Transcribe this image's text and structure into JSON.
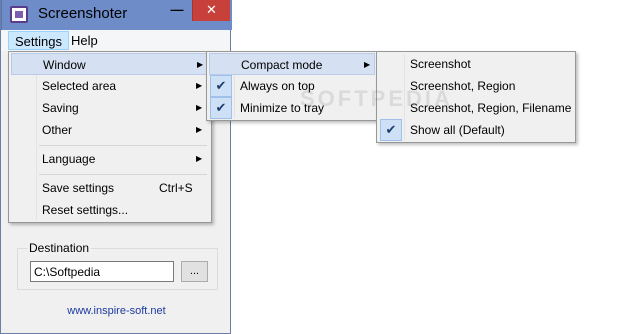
{
  "window": {
    "title": "Screenshoter",
    "minimize_glyph": "—",
    "close_glyph": "✕",
    "icon": "screenshoter-app-icon"
  },
  "menubar": {
    "settings": "Settings",
    "help": "Help"
  },
  "settings_menu": {
    "items": [
      {
        "label": "Window",
        "submenu": true
      },
      {
        "label": "Selected area",
        "submenu": true
      },
      {
        "label": "Saving",
        "submenu": true
      },
      {
        "label": "Other",
        "submenu": true
      },
      {
        "label": "Language",
        "submenu": true
      },
      {
        "label": "Save settings",
        "shortcut": "Ctrl+S"
      },
      {
        "label": "Reset settings..."
      }
    ]
  },
  "window_menu": {
    "items": [
      {
        "label": "Compact mode",
        "submenu": true,
        "checked": false
      },
      {
        "label": "Always on top",
        "checked": true
      },
      {
        "label": "Minimize to tray",
        "checked": true
      }
    ]
  },
  "compact_menu": {
    "items": [
      {
        "label": "Screenshot",
        "checked": false
      },
      {
        "label": "Screenshot, Region",
        "checked": false
      },
      {
        "label": "Screenshot, Region, Filename",
        "checked": false
      },
      {
        "label": "Show all (Default)",
        "checked": true
      }
    ]
  },
  "destination": {
    "label": "Destination",
    "value": "C:\\Softpedia",
    "browse_label": "..."
  },
  "footer": {
    "link": "www.inspire-soft.net"
  },
  "glyphs": {
    "arrow": "▶",
    "check": "✔"
  },
  "watermark": "SOFTPEDIA",
  "colors": {
    "titlebar": "#6e8cc8",
    "close_button": "#c7413a",
    "menu_highlight": "#d5e1f2",
    "link": "#1c3aa0"
  }
}
